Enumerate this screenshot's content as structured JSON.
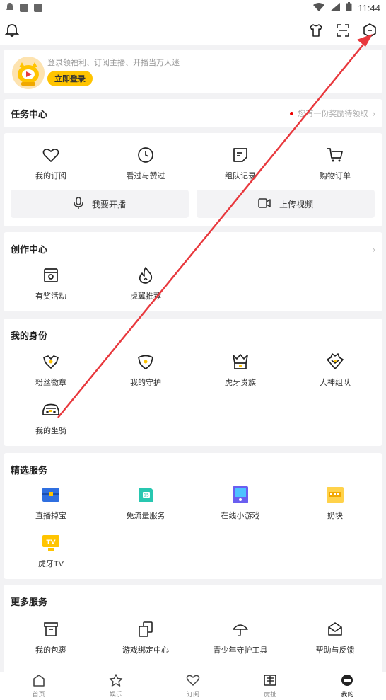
{
  "status": {
    "time": "11:44"
  },
  "login": {
    "tip": "登录领福利、订阅主播、开播当万人迷",
    "button": "立即登录"
  },
  "task": {
    "title": "任务中心",
    "hint": "您有一份奖励待领取"
  },
  "quick": {
    "items": [
      {
        "label": "我的订阅",
        "icon": "heart-icon"
      },
      {
        "label": "看过与赞过",
        "icon": "clock-icon"
      },
      {
        "label": "组队记录",
        "icon": "note-icon"
      },
      {
        "label": "购物订单",
        "icon": "cart-icon"
      }
    ],
    "broadcast": "我要开播",
    "upload": "上传视频"
  },
  "create": {
    "title": "创作中心",
    "items": [
      {
        "label": "有奖活动",
        "icon": "gift-box-icon"
      },
      {
        "label": "虎翼推荐",
        "icon": "flame-icon"
      }
    ]
  },
  "identity": {
    "title": "我的身份",
    "items": [
      {
        "label": "粉丝徽章",
        "icon": "fan-badge-icon"
      },
      {
        "label": "我的守护",
        "icon": "shield-icon"
      },
      {
        "label": "虎牙贵族",
        "icon": "crown-icon"
      },
      {
        "label": "大神组队",
        "icon": "diamond-icon"
      },
      {
        "label": "我的坐骑",
        "icon": "car-icon"
      }
    ]
  },
  "service": {
    "title": "精选服务",
    "items": [
      {
        "label": "直播掉宝",
        "icon": "treasure-icon"
      },
      {
        "label": "免流量服务",
        "icon": "data-free-icon"
      },
      {
        "label": "在线小游戏",
        "icon": "game-icon"
      },
      {
        "label": "奶块",
        "icon": "naikuai-icon"
      },
      {
        "label": "虎牙TV",
        "icon": "tv-icon"
      }
    ]
  },
  "more": {
    "title": "更多服务",
    "items": [
      {
        "label": "我的包裹",
        "icon": "package-icon"
      },
      {
        "label": "游戏绑定中心",
        "icon": "bind-icon"
      },
      {
        "label": "青少年守护工具",
        "icon": "umbrella-icon"
      },
      {
        "label": "帮助与反馈",
        "icon": "help-icon"
      }
    ]
  },
  "nav": [
    {
      "label": "首页",
      "icon": "home-icon"
    },
    {
      "label": "娱乐",
      "icon": "star-icon"
    },
    {
      "label": "订阅",
      "icon": "heart-icon"
    },
    {
      "label": "虎扯",
      "icon": "huche-icon"
    },
    {
      "label": "我的",
      "icon": "profile-icon"
    }
  ],
  "colors": {
    "accent": "#ffc400",
    "annotation": "#e8383d",
    "badge_red": "#e00000"
  }
}
